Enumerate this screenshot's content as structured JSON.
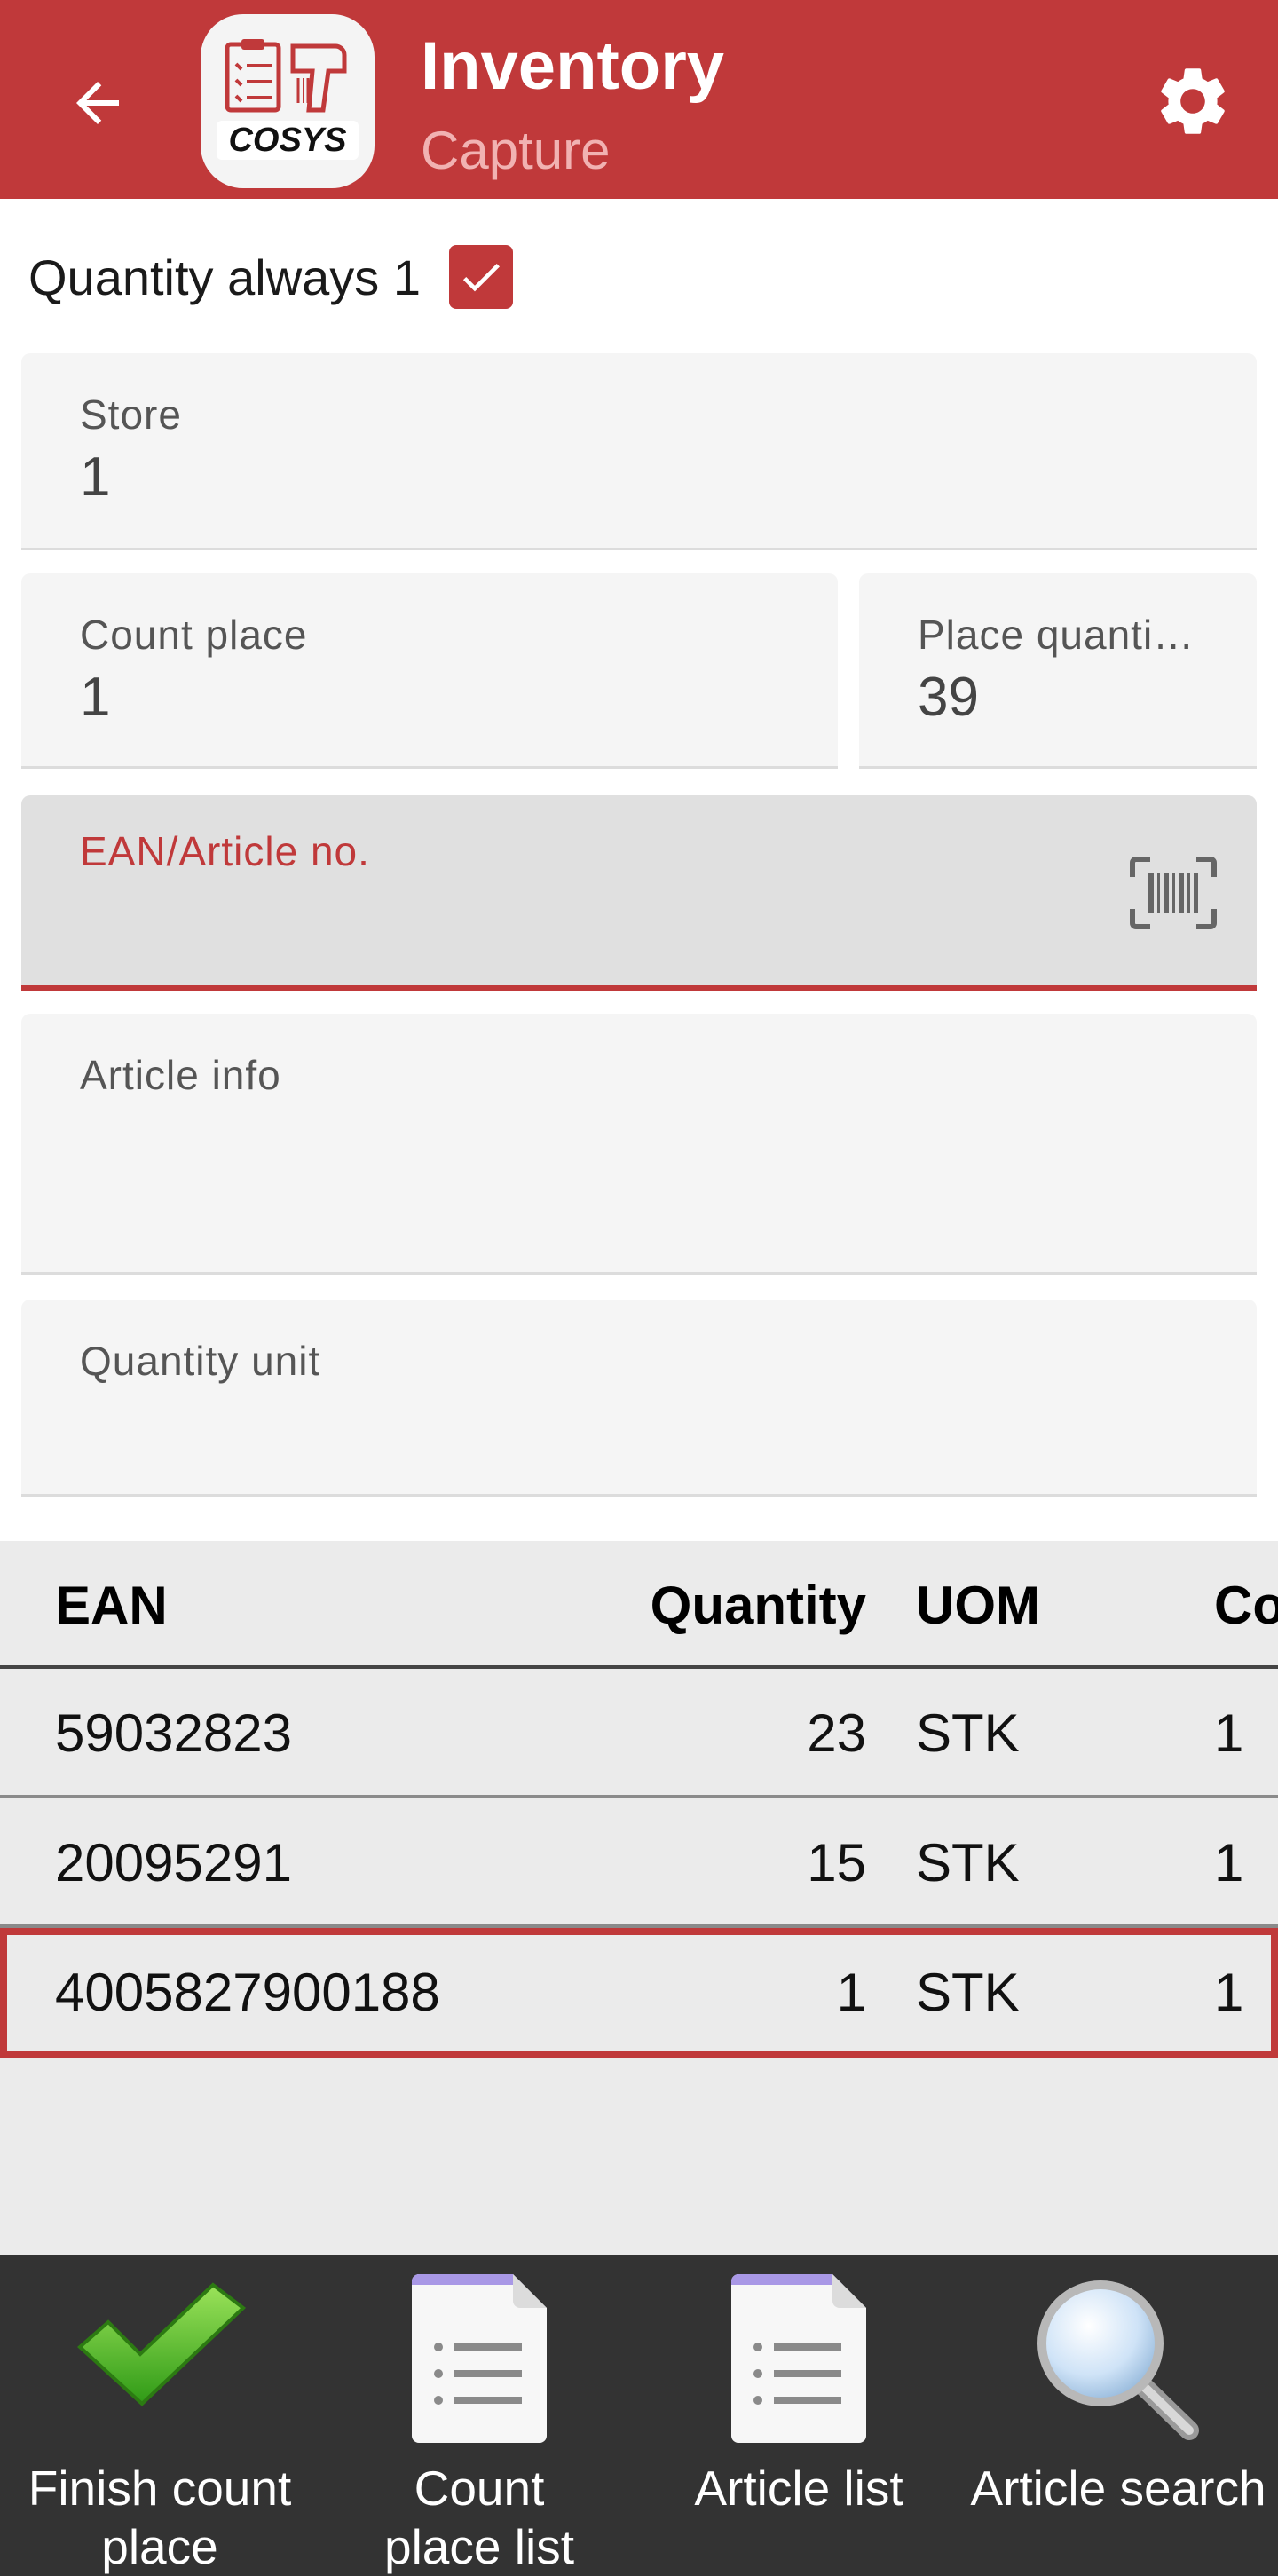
{
  "header": {
    "title": "Inventory",
    "subtitle": "Capture",
    "logo_text": "COSYS"
  },
  "form": {
    "quantity_always_label": "Quantity always 1",
    "quantity_always_checked": true,
    "store": {
      "label": "Store",
      "value": "1"
    },
    "count_place": {
      "label": "Count place",
      "value": "1"
    },
    "place_quantity": {
      "label": "Place quanti…",
      "value": "39"
    },
    "ean": {
      "label": "EAN/Article no.",
      "value": ""
    },
    "article_info": {
      "label": "Article info",
      "value": ""
    },
    "quantity_unit": {
      "label": "Quantity unit",
      "value": ""
    }
  },
  "table": {
    "columns": [
      "EAN",
      "Quantity",
      "UOM",
      "Co"
    ],
    "rows": [
      {
        "ean": "59032823",
        "quantity": "23",
        "uom": "STK",
        "co": "1"
      },
      {
        "ean": "20095291",
        "quantity": "15",
        "uom": "STK",
        "co": "1"
      },
      {
        "ean": "4005827900188",
        "quantity": "1",
        "uom": "STK",
        "co": "1",
        "selected": true
      }
    ]
  },
  "bottom_bar": {
    "finish": "Finish count place",
    "count_place_list": "Count place list",
    "article_list": "Article list",
    "article_search": "Article search"
  },
  "colors": {
    "primary": "#c0393a",
    "subtitle": "#f1b2b2",
    "bottom_bar": "#333333"
  }
}
